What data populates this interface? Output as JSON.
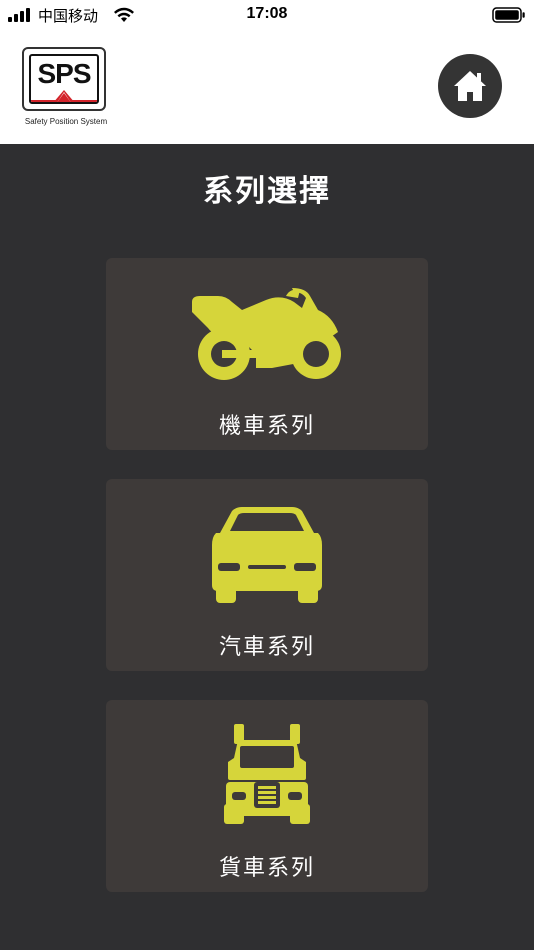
{
  "status_bar": {
    "carrier": "中国移动",
    "time": "17:08"
  },
  "header": {
    "logo_text": "SPS",
    "logo_caption": "Safety Position System",
    "home_icon": "home-icon"
  },
  "page": {
    "title": "系列選擇"
  },
  "series": [
    {
      "label": "機車系列",
      "icon": "motorcycle-icon"
    },
    {
      "label": "汽車系列",
      "icon": "car-icon"
    },
    {
      "label": "貨車系列",
      "icon": "truck-icon"
    }
  ],
  "colors": {
    "background": "#2f2f31",
    "card": "#3e3a39",
    "accent": "#d6d53a",
    "logo_red": "#d3242b"
  }
}
